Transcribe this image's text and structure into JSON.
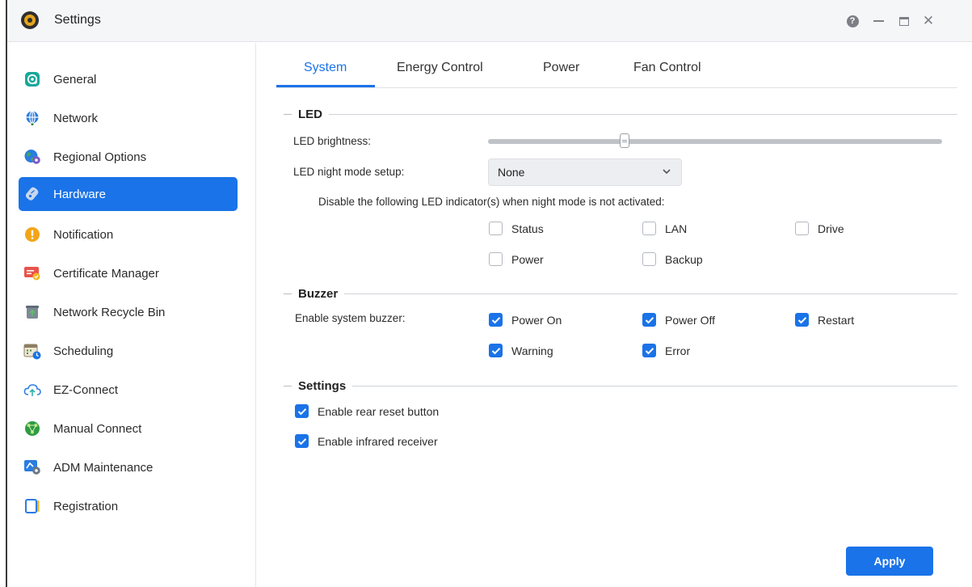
{
  "window": {
    "title": "Settings",
    "help_symbol": "?",
    "close_symbol": "✕"
  },
  "sidebar": {
    "items": [
      {
        "label": "General",
        "icon": "general-icon"
      },
      {
        "label": "Network",
        "icon": "globe-icon"
      },
      {
        "label": "Regional Options",
        "icon": "regional-globe-icon"
      },
      {
        "label": "Hardware",
        "icon": "hardware-icon",
        "selected": true
      },
      {
        "label": "Notification",
        "icon": "notification-icon"
      },
      {
        "label": "Certificate Manager",
        "icon": "certificate-icon"
      },
      {
        "label": "Network Recycle Bin",
        "icon": "recycle-bin-icon"
      },
      {
        "label": "Scheduling",
        "icon": "calendar-clock-icon"
      },
      {
        "label": "EZ-Connect",
        "icon": "cloud-upload-icon"
      },
      {
        "label": "Manual Connect",
        "icon": "manual-connect-icon"
      },
      {
        "label": "ADM Maintenance",
        "icon": "maintenance-icon"
      },
      {
        "label": "Registration",
        "icon": "registration-icon"
      }
    ]
  },
  "tabs": [
    {
      "label": "System",
      "active": true
    },
    {
      "label": "Energy Control"
    },
    {
      "label": "Power"
    },
    {
      "label": "Fan Control"
    }
  ],
  "led": {
    "title": "LED",
    "brightness_label": "LED brightness:",
    "brightness_value": 0.3,
    "night_mode_label": "LED night mode setup:",
    "night_mode_value": "None",
    "disable_text": "Disable the following LED indicator(s) when night mode is not activated:",
    "indicators": [
      {
        "label": "Status",
        "checked": false
      },
      {
        "label": "LAN",
        "checked": false
      },
      {
        "label": "Drive",
        "checked": false
      },
      {
        "label": "Power",
        "checked": false
      },
      {
        "label": "Backup",
        "checked": false
      }
    ]
  },
  "buzzer": {
    "title": "Buzzer",
    "enable_label": "Enable system buzzer:",
    "options": [
      {
        "label": "Power On",
        "checked": true
      },
      {
        "label": "Power Off",
        "checked": true
      },
      {
        "label": "Restart",
        "checked": true
      },
      {
        "label": "Warning",
        "checked": true
      },
      {
        "label": "Error",
        "checked": true
      }
    ]
  },
  "settings": {
    "title": "Settings",
    "options": [
      {
        "label": "Enable rear reset button",
        "checked": true
      },
      {
        "label": "Enable infrared receiver",
        "checked": true
      }
    ]
  },
  "apply_label": "Apply",
  "colors": {
    "accent": "#1a73e8"
  }
}
